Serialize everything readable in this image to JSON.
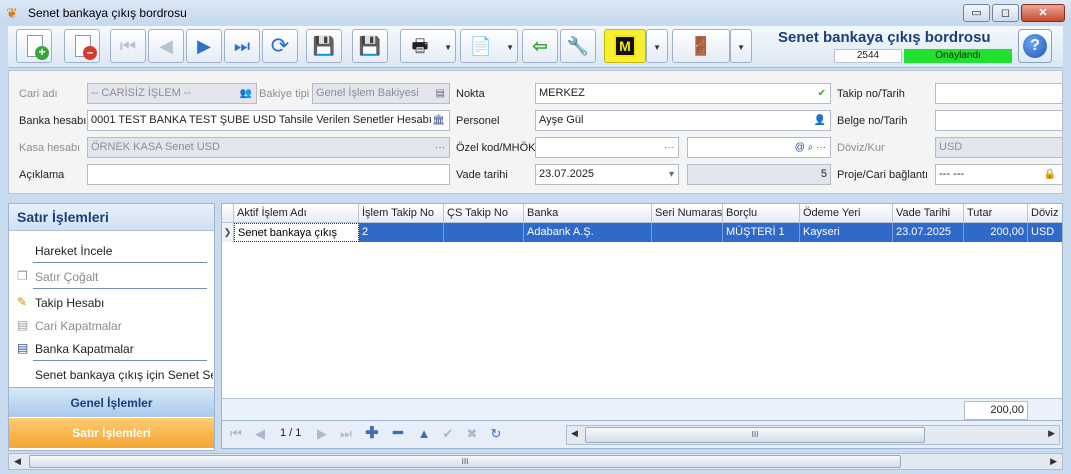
{
  "window": {
    "title": "Senet bankaya çıkış bordrosu",
    "app_icon": "butterfly-icon",
    "controls": {
      "minimize": "▭",
      "maximize": "◻",
      "close": "✕"
    }
  },
  "toolbar": {
    "buttons": [
      {
        "name": "new-document-button",
        "icon": "new-document-icon",
        "enabled": true
      },
      {
        "name": "delete-document-button",
        "icon": "delete-document-icon",
        "enabled": true
      },
      {
        "name": "first-record-button",
        "icon": "first-record-icon",
        "glyph": "⏮",
        "enabled": false
      },
      {
        "name": "previous-record-button",
        "icon": "previous-record-icon",
        "glyph": "◀",
        "enabled": false
      },
      {
        "name": "next-record-button",
        "icon": "next-record-icon",
        "glyph": "▶",
        "enabled": true
      },
      {
        "name": "last-record-button",
        "icon": "last-record-icon",
        "glyph": "⏭",
        "enabled": true
      },
      {
        "name": "refresh-button",
        "icon": "refresh-icon",
        "glyph": "⟳",
        "enabled": true
      },
      {
        "name": "save-button",
        "icon": "save-icon",
        "glyph": "💾",
        "enabled": false
      },
      {
        "name": "cancel-save-button",
        "icon": "cancel-save-icon",
        "glyph": "💾",
        "enabled": false
      },
      {
        "name": "print-button",
        "icon": "printer-icon",
        "glyph": "🖶",
        "enabled": true
      },
      {
        "name": "export-pdf-button",
        "icon": "pdf-export-icon",
        "glyph": "📄",
        "enabled": true
      },
      {
        "name": "import-button",
        "icon": "import-icon",
        "glyph": "⇦",
        "enabled": true
      },
      {
        "name": "tools-button",
        "icon": "wrench-icon",
        "glyph": "🔧",
        "enabled": true
      },
      {
        "name": "m-module-button",
        "icon": "m-logo-icon",
        "glyph": "M",
        "enabled": true
      },
      {
        "name": "exit-button",
        "icon": "exit-door-icon",
        "glyph": "🚪",
        "enabled": true
      }
    ],
    "form_title": "Senet bankaya çıkış bordrosu",
    "document_number": "2544",
    "document_status": "Onaylandı",
    "help_glyph": "?"
  },
  "form": {
    "cari_adi": {
      "label": "Cari adı",
      "value": "-- CARİSİZ İŞLEM --"
    },
    "bakiye_tipi": {
      "label": "Bakiye tipi",
      "value": "Genel İşlem Bakiyesi"
    },
    "banka_hesabi": {
      "label": "Banka hesabı",
      "value": "0001 TEST BANKA TEST ŞUBE USD Tahsile Verilen Senetler Hesabı"
    },
    "kasa_hesabi": {
      "label": "Kasa hesabı",
      "value": "ÖRNEK KASA Senet USD"
    },
    "aciklama": {
      "label": "Açıklama",
      "value": ""
    },
    "nokta": {
      "label": "Nokta",
      "value": "MERKEZ"
    },
    "personel": {
      "label": "Personel",
      "value": "Ayşe Gül"
    },
    "ozel_kod": {
      "label": "Özel kod/MHÖK",
      "value": "",
      "value2": ""
    },
    "vade_tarihi": {
      "label": "Vade tarihi",
      "value": "23.07.2025",
      "days": "5"
    },
    "takip_no": {
      "label": "Takip no/Tarih",
      "value": ""
    },
    "belge_no": {
      "label": "Belge no/Tarih",
      "value": ""
    },
    "doviz_kur": {
      "label": "Döviz/Kur",
      "value": "USD"
    },
    "proje": {
      "label": "Proje/Cari bağlantı",
      "value": "--- ---"
    }
  },
  "side_panel": {
    "header": "Satır İşlemleri",
    "items": [
      {
        "label": "Hareket İncele",
        "enabled": true,
        "icon": ""
      },
      {
        "label": "Satır Çoğalt",
        "enabled": false,
        "icon": "copy-row-icon"
      },
      {
        "label": "Takip Hesabı",
        "enabled": true,
        "icon": "tracking-account-icon"
      },
      {
        "label": "Cari Kapatmalar",
        "enabled": false,
        "icon": "current-closing-icon"
      },
      {
        "label": "Banka Kapatmalar",
        "enabled": true,
        "icon": "bank-closing-icon"
      },
      {
        "label": "Senet bankaya çıkış için Senet Seç",
        "enabled": true,
        "icon": ""
      }
    ],
    "tabs": {
      "genel": "Genel İşlemler",
      "satir": "Satır İşlemleri"
    }
  },
  "grid": {
    "columns": [
      "Aktif İşlem Adı",
      "İşlem Takip No",
      "ÇS Takip No",
      "Banka",
      "Seri Numarası",
      "Borçlu",
      "Ödeme Yeri",
      "Vade Tarihi",
      "Tutar",
      "Döviz"
    ],
    "rows": [
      [
        "Senet bankaya çıkış",
        "2",
        "",
        "Adabank A.Ş.",
        "",
        "MÜŞTERİ 1",
        "Kayseri",
        "23.07.2025",
        "200,00",
        "USD"
      ]
    ],
    "total": "200,00"
  },
  "navigator": {
    "page_text": "1 / 1",
    "scroll_thumb": "III"
  },
  "bottom_scroll": {
    "thumb": "III"
  }
}
